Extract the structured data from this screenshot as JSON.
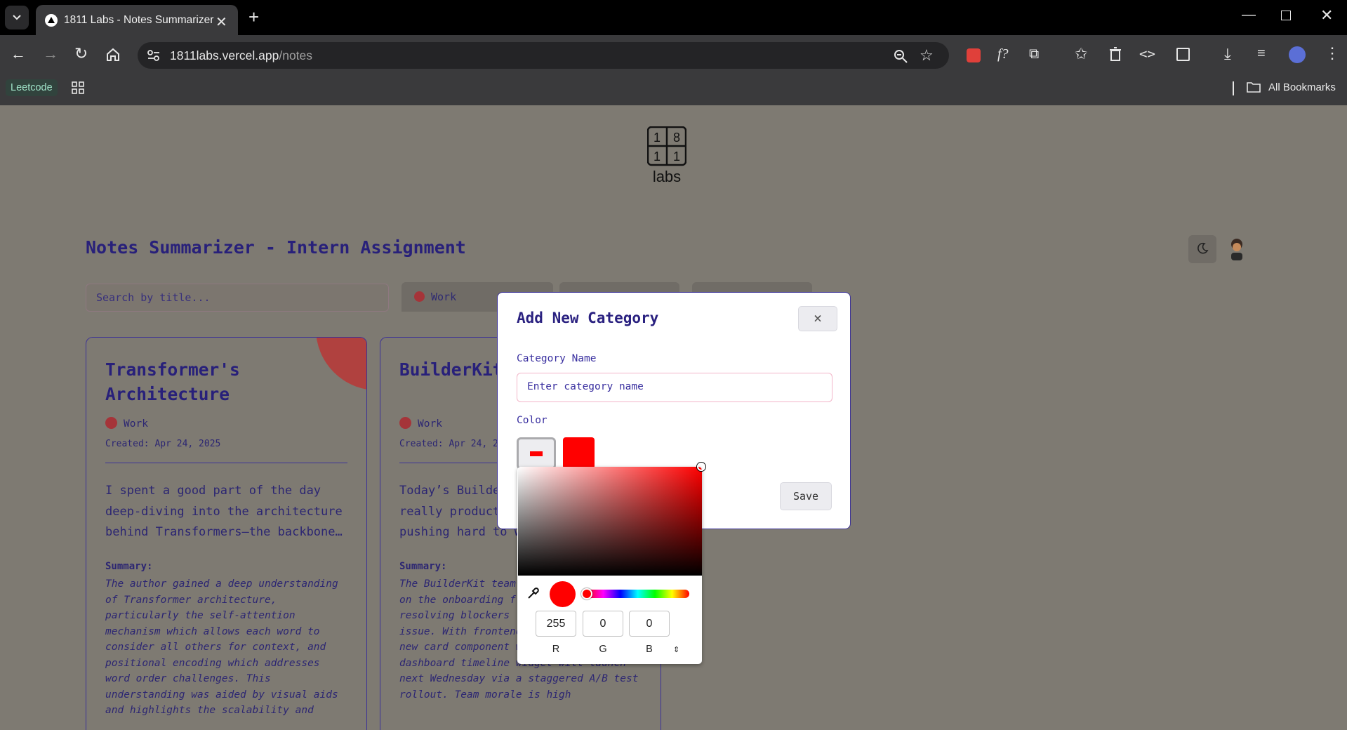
{
  "browser": {
    "tab_title": "1811 Labs - Notes Summarizer",
    "url_host": "1811labs.vercel.app",
    "url_path": "/notes",
    "bookmarks": {
      "leetcode": "Leetcode",
      "all_bookmarks": "All Bookmarks"
    }
  },
  "page": {
    "logo": {
      "digits": [
        "1",
        "8",
        "1",
        "1"
      ],
      "text": "labs"
    },
    "title": "Notes Summarizer - Intern Assignment",
    "search_placeholder": "Search by title...",
    "filters": [
      {
        "label": "Work",
        "color": "#a53439"
      },
      {
        "label": ""
      },
      {
        "label": ""
      }
    ],
    "cards": [
      {
        "title": "Transformer's Architecture",
        "category": "Work",
        "created": "Created: Apr 24, 2025",
        "body": "I spent a good part of the day deep-diving into the architecture behind Transformers—the backbone…",
        "summary_heading": "Summary:",
        "summary": "The author gained a deep understanding of Transformer architecture, particularly the self-attention mechanism which allows each word to consider all others for context, and positional encoding which addresses word order challenges. This understanding was aided by visual aids and highlights the scalability and"
      },
      {
        "title": "BuilderKit Summary",
        "category": "Work",
        "created": "Created: Apr 24, 2025",
        "body": "Today’s BuilderKit standup was really productive. The team is pushing hard to wrap up…",
        "summary_heading": "Summary:",
        "summary": "The BuilderKit team made good progress on the onboarding flow redesign, resolving blockers like a Google OAuth issue. With frontend completion near, a new card component will … a new dashboard timeline widget will launch next Wednesday via a staggered A/B test rollout. Team morale is high"
      }
    ]
  },
  "modal": {
    "title": "Add New Category",
    "close_symbol": "×",
    "name_label": "Category Name",
    "name_placeholder": "Enter category name",
    "color_label": "Color",
    "save_label": "Save",
    "selected_color": "#ff0000"
  },
  "picker": {
    "r": "255",
    "g": "0",
    "b": "0",
    "labels": {
      "r": "R",
      "g": "G",
      "b": "B"
    }
  },
  "icons": [
    "tab-search-icon",
    "favicon-icon",
    "close-tab-icon",
    "new-tab-icon",
    "minimize-icon",
    "restore-icon",
    "close-window-icon",
    "back-icon",
    "forward-icon",
    "reload-icon",
    "home-icon",
    "site-settings-icon",
    "zoom-icon",
    "star-icon",
    "extension-icon",
    "puzzle-icon",
    "download-icon",
    "moon-icon",
    "eyedropper-icon"
  ]
}
